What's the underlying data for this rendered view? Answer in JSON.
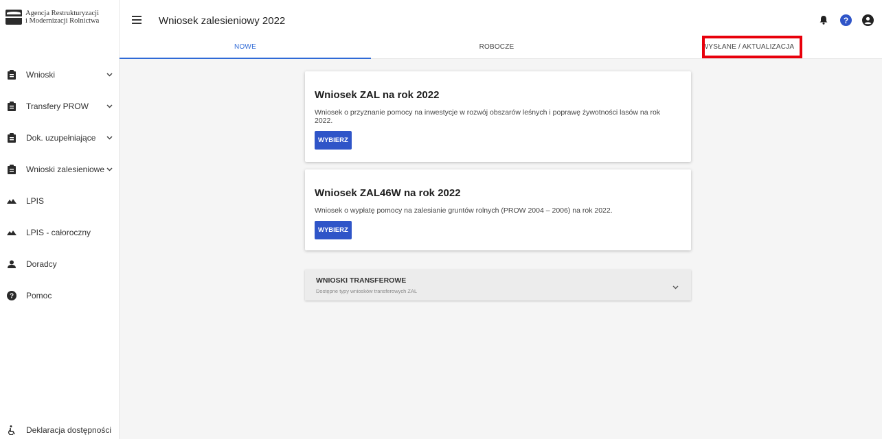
{
  "logo": {
    "line1": "Agencja Restrukturyzacji",
    "line2": "i Modernizacji Rolnictwa"
  },
  "header": {
    "title": "Wniosek zalesieniowy 2022"
  },
  "tabs": [
    {
      "label": "NOWE",
      "active": true
    },
    {
      "label": "ROBOCZE",
      "active": false
    },
    {
      "label": "WYSŁANE / AKTUALIZACJA",
      "active": false
    }
  ],
  "sidebar": {
    "items": [
      {
        "label": "Wnioski",
        "icon": "clipboard-icon",
        "expandable": true
      },
      {
        "label": "Transfery PROW",
        "icon": "clipboard-icon",
        "expandable": true
      },
      {
        "label": "Dok. uzupełniające",
        "icon": "clipboard-icon",
        "expandable": true
      },
      {
        "label": "Wnioski zalesieniowe",
        "icon": "clipboard-icon",
        "expandable": true
      },
      {
        "label": "LPIS",
        "icon": "terrain-icon",
        "expandable": false
      },
      {
        "label": "LPIS - całoroczny",
        "icon": "terrain-icon",
        "expandable": false
      },
      {
        "label": "Doradcy",
        "icon": "person-icon",
        "expandable": false
      },
      {
        "label": "Pomoc",
        "icon": "help-icon",
        "expandable": false
      }
    ],
    "footer": {
      "label": "Deklaracja dostępności",
      "icon": "accessibility-icon"
    }
  },
  "cards": [
    {
      "title": "Wniosek ZAL na rok 2022",
      "description": "Wniosek o przyznanie pomocy na inwestycje w rozwój obszarów leśnych i poprawę żywotności lasów na rok 2022.",
      "button": "WYBIERZ"
    },
    {
      "title": "Wniosek ZAL46W na rok 2022",
      "description": "Wniosek o wypłatę pomocy na zalesianie gruntów rolnych (PROW 2004 – 2006) na rok 2022.",
      "button": "WYBIERZ"
    }
  ],
  "accordion": {
    "title": "WNIOSKI TRANSFEROWE",
    "subtitle": "Dostępne typy wniosków transferowych ZAL"
  },
  "colors": {
    "accent": "#2f6ad6",
    "button": "#2f55c8",
    "highlight": "#e8000b"
  }
}
